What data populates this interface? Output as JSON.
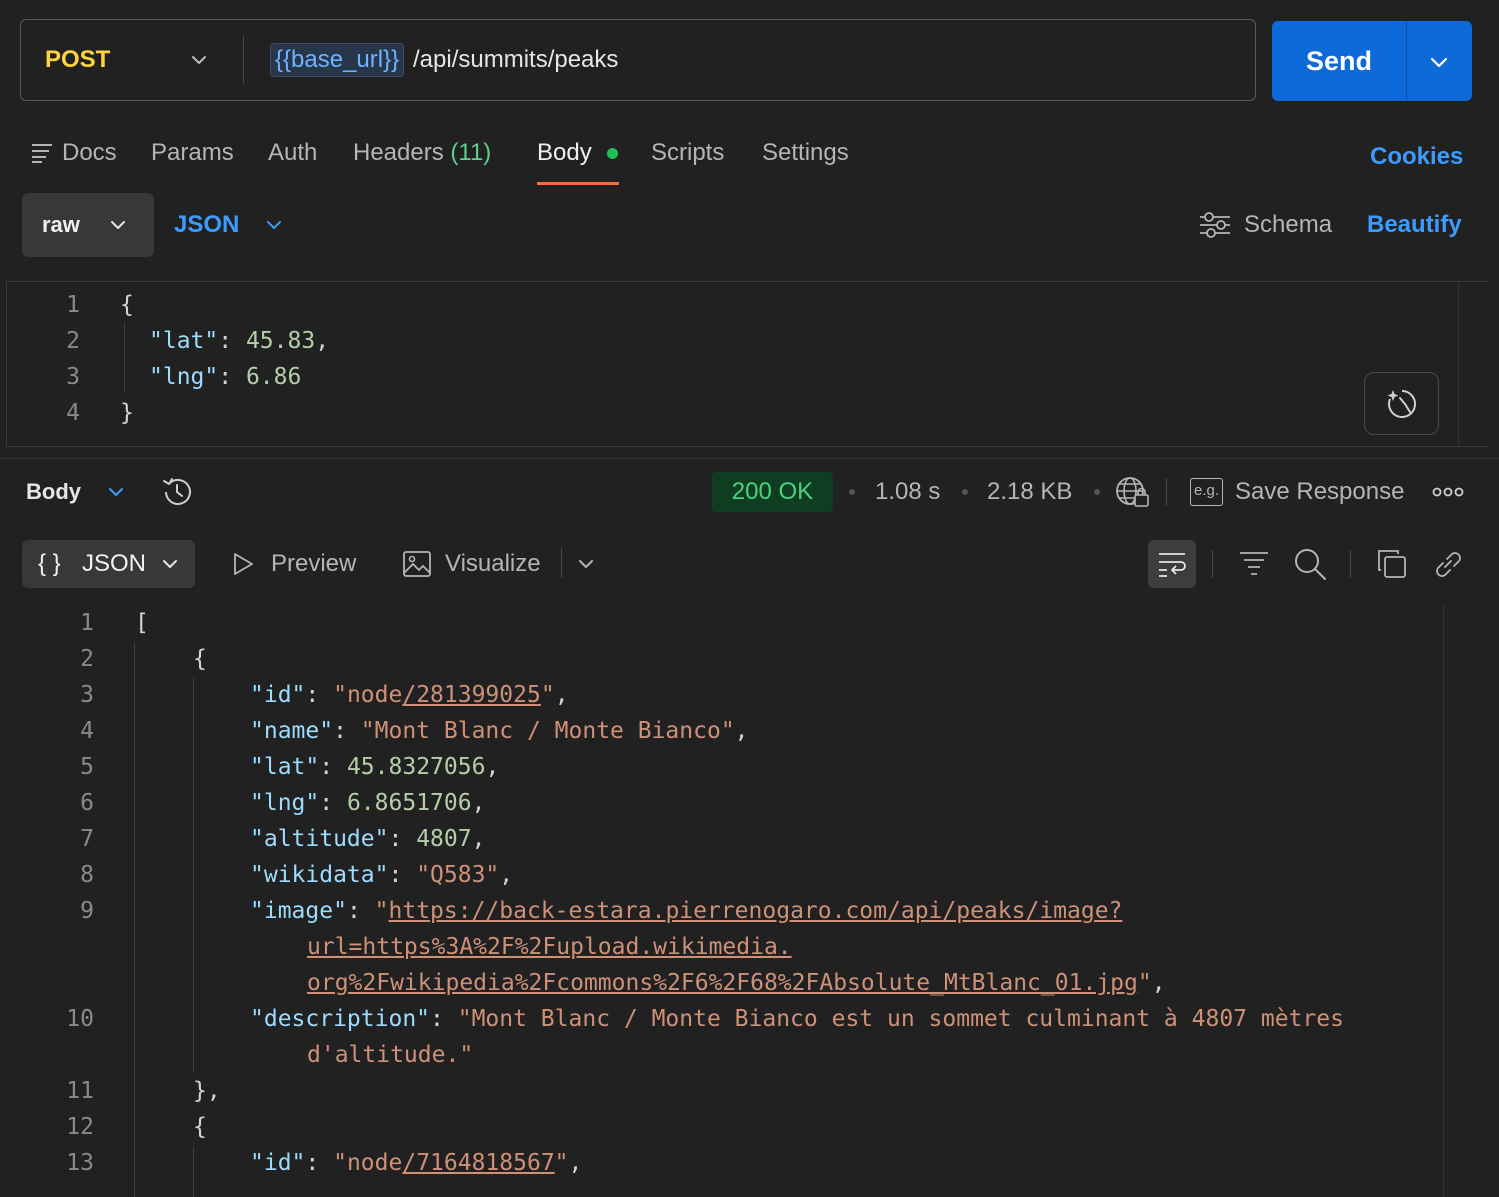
{
  "request": {
    "method": "POST",
    "base_url": "{{base_url}}",
    "path": "/api/summits/peaks",
    "send_label": "Send"
  },
  "tabs": {
    "docs": "Docs",
    "params": "Params",
    "auth": "Auth",
    "headers": "Headers",
    "headers_count": "(11)",
    "body": "Body",
    "scripts": "Scripts",
    "settings": "Settings",
    "cookies": "Cookies"
  },
  "body_options": {
    "mode": "raw",
    "language": "JSON",
    "schema": "Schema",
    "beautify": "Beautify"
  },
  "request_body": {
    "line_numbers": [
      "1",
      "2",
      "3",
      "4"
    ],
    "open_brace": "{",
    "close_brace": "}",
    "lat_key": "\"lat\"",
    "lat_value": "45.83",
    "lng_key": "\"lng\"",
    "lng_value": "6.86"
  },
  "response_bar": {
    "body_label": "Body",
    "status": "200 OK",
    "time": "1.08 s",
    "size": "2.18 KB",
    "eg_icon_text": "e.g.",
    "save_response": "Save Response"
  },
  "response_view": {
    "braces": "{ }",
    "format": "JSON",
    "preview": "Preview",
    "visualize": "Visualize"
  },
  "response_body": {
    "line_numbers": [
      "1",
      "2",
      "3",
      "4",
      "5",
      "6",
      "7",
      "8",
      "9",
      "10",
      "11",
      "12",
      "13"
    ],
    "bracket_open": "[",
    "obj_open": "{",
    "obj_close": "},",
    "obj2_open": "{",
    "id_key": "\"id\"",
    "id_prefix": "\"node",
    "id_num": "/281399025",
    "name_key": "\"name\"",
    "name_value": "\"Mont Blanc / Monte Bianco\"",
    "lat_key": "\"lat\"",
    "lat_value": "45.8327056",
    "lng_key": "\"lng\"",
    "lng_value": "6.8651706",
    "altitude_key": "\"altitude\"",
    "altitude_value": "4807",
    "wikidata_key": "\"wikidata\"",
    "wikidata_value": "\"Q583\"",
    "image_key": "\"image\"",
    "image_line1": "https://back-estara.pierrenogaro.com/api/peaks/image?",
    "image_line2": "url=https%3A%2F%2Fupload.wikimedia.",
    "image_line3": "org%2Fwikipedia%2Fcommons%2F6%2F68%2FAbsolute_MtBlanc_01.jpg",
    "description_key": "\"description\"",
    "description_line1": "\"Mont Blanc / Monte Bianco est un sommet culminant à 4807 mètres",
    "description_line2": "d'altitude.\"",
    "id2_key": "\"id\"",
    "id2_prefix": "\"node",
    "id2_num": "/7164818567"
  }
}
